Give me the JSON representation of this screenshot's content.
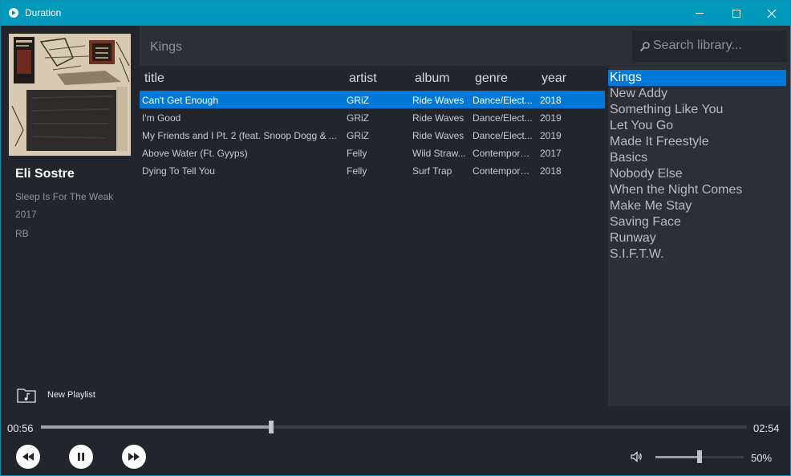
{
  "window": {
    "title": "Duration"
  },
  "now_playing": {
    "artist": "Eli Sostre",
    "album": "Sleep Is For The Weak",
    "year": "2017",
    "genre": "RB"
  },
  "new_playlist_label": "New Playlist",
  "header": {
    "playlist_name": "Kings",
    "search_placeholder": "Search library..."
  },
  "table": {
    "columns": [
      "title",
      "artist",
      "album",
      "genre",
      "year"
    ],
    "rows": [
      {
        "title": "Can't Get Enough",
        "artist": "GRiZ",
        "album": "Ride Waves",
        "genre": "Dance/Elect...",
        "year": "2018",
        "selected": true
      },
      {
        "title": "I'm Good",
        "artist": "GRiZ",
        "album": "Ride Waves",
        "genre": "Dance/Elect...",
        "year": "2019"
      },
      {
        "title": "My Friends and I Pt. 2 (feat. Snoop Dogg & ...",
        "artist": "GRiZ",
        "album": "Ride Waves",
        "genre": "Dance/Elect...",
        "year": "2019"
      },
      {
        "title": "Above Water (Ft. Gyyps)",
        "artist": "Felly",
        "album": "Wild Straw...",
        "genre": "Contempora...",
        "year": "2017"
      },
      {
        "title": "Dying To Tell You",
        "artist": "Felly",
        "album": "Surf Trap",
        "genre": "Contempora...",
        "year": "2018"
      }
    ]
  },
  "playlists": {
    "items": [
      "Kings",
      "New Addy",
      "Something Like You",
      "Let You Go",
      "Made It Freestyle",
      "Basics",
      "Nobody Else",
      "When the Night Comes",
      "Make Me Stay",
      "Saving Face",
      "Runway",
      "S.I.F.T.W."
    ],
    "active_index": 0
  },
  "player": {
    "current_time": "00:56",
    "total_time": "02:54",
    "progress_fraction": 0.326,
    "volume_label": "50%",
    "volume_fraction": 0.5
  },
  "colors": {
    "titlebar": "#0099bc",
    "selection": "#0078d7",
    "background": "#22252b",
    "panel": "#2c2f35"
  },
  "icons": {
    "app": "play-circle-icon",
    "new_playlist": "folder-music-icon",
    "search": "search-icon",
    "rewind": "rewind-icon",
    "pause": "pause-icon",
    "forward": "fast-forward-icon",
    "volume": "volume-icon"
  }
}
